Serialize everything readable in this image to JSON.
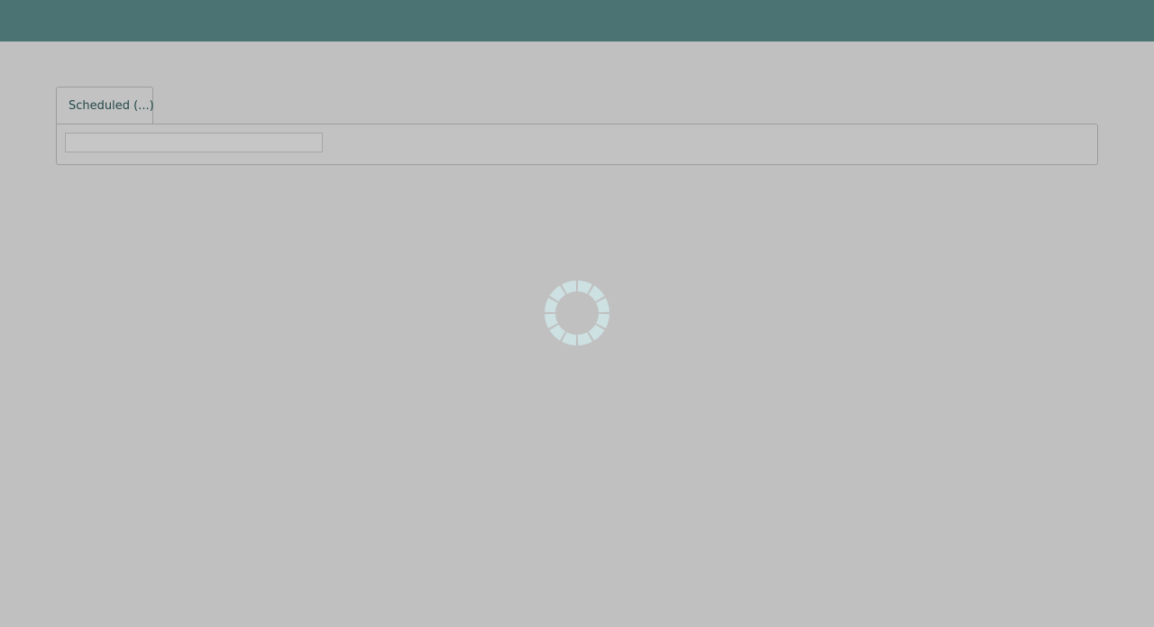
{
  "header": {
    "background_color": "#4c7373"
  },
  "tabs": [
    {
      "label": "Scheduled (...)",
      "active": true
    }
  ],
  "search": {
    "value": "",
    "placeholder": ""
  },
  "loading": {
    "icon": "loading-spinner-icon",
    "color": "#cde0e2"
  }
}
